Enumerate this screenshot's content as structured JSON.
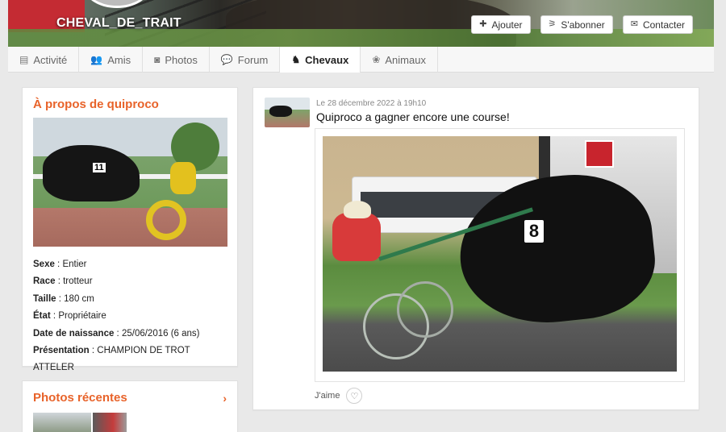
{
  "profile": {
    "name": "CHEVAL_DE_TRAIT",
    "actions": [
      {
        "label": "Ajouter",
        "icon": "add-user-icon"
      },
      {
        "label": "S'abonner",
        "icon": "rss-icon"
      },
      {
        "label": "Contacter",
        "icon": "envelope-icon"
      }
    ]
  },
  "tabs": [
    {
      "label": "Activité",
      "icon": "newspaper-icon",
      "active": false
    },
    {
      "label": "Amis",
      "icon": "users-icon",
      "active": false
    },
    {
      "label": "Photos",
      "icon": "camera-icon",
      "active": false
    },
    {
      "label": "Forum",
      "icon": "chat-icon",
      "active": false
    },
    {
      "label": "Chevaux",
      "icon": "horse-icon",
      "active": true
    },
    {
      "label": "Animaux",
      "icon": "paw-icon",
      "active": false
    }
  ],
  "about": {
    "title": "À propos de quiproco",
    "photo_number": "11",
    "fields": [
      {
        "label": "Sexe",
        "value": "Entier"
      },
      {
        "label": "Race",
        "value": "trotteur"
      },
      {
        "label": "Taille",
        "value": "180 cm"
      },
      {
        "label": "État",
        "value": "Propriétaire"
      },
      {
        "label": "Date de naissance",
        "value": "25/06/2016 (6 ans)"
      },
      {
        "label": "Présentation",
        "value": "CHAMPION DE TROT ATTELER"
      }
    ]
  },
  "recent_photos": {
    "title": "Photos récentes"
  },
  "post": {
    "date": "Le 28 décembre 2022 à 19h10",
    "text": "Quiproco a gagner encore une course!",
    "bib_number": "8",
    "like_label": "J'aime"
  },
  "colors": {
    "accent": "#e8632a",
    "background": "#e9e9e9"
  }
}
